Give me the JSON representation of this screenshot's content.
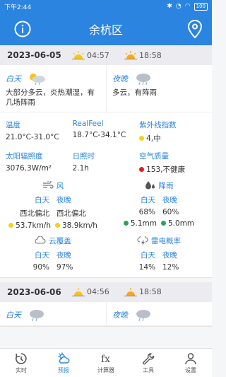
{
  "status": {
    "time": "下午2:44",
    "battery": "100"
  },
  "header": {
    "title": "余杭区"
  },
  "days": [
    {
      "date": "2023-06-05",
      "sunrise": "04:57",
      "sunset": "18:58",
      "day_label": "白天",
      "night_label": "夜晚",
      "day_desc": "大部分多云，炎热潮湿，有几场阵雨",
      "night_desc": "多云，有阵雨",
      "stats": {
        "temp_label": "温度",
        "temp_value": "21.0°C-31.0°C",
        "realfeel_label": "RealFeel",
        "realfeel_value": "18.7°C-34.1°C",
        "uv_label": "紫外线指数",
        "uv_value": "4,中",
        "solar_label": "太阳辐照度",
        "solar_value": "3076.3W/m²",
        "sunshine_label": "日照时",
        "sunshine_value": "2.1h",
        "aqi_label": "空气质量",
        "aqi_value": "153,不健康"
      },
      "wind": {
        "label": "风",
        "day": "白天",
        "night": "夜晚",
        "dir_day": "西北偏北",
        "dir_night": "西北偏北",
        "speed_day": "53.7km/h",
        "speed_night": "38.9km/h"
      },
      "rain": {
        "label": "降雨",
        "day": "白天",
        "night": "夜晚",
        "prob_day": "68%",
        "prob_night": "60%",
        "amt_day": "5.1mm",
        "amt_night": "5.0mm"
      },
      "cloud": {
        "label": "云覆盖",
        "day": "白天",
        "night": "夜晚",
        "val_day": "90%",
        "val_night": "97%"
      },
      "thunder": {
        "label": "雷电概率",
        "day": "白天",
        "night": "夜晚",
        "val_day": "14%",
        "val_night": "12%"
      }
    },
    {
      "date": "2023-06-06",
      "sunrise": "04:56",
      "sunset": "18:58",
      "day_label": "白天",
      "night_label": "夜晚"
    }
  ],
  "tabs": [
    {
      "label": "实时",
      "icon": "realtime-icon"
    },
    {
      "label": "预报",
      "icon": "forecast-icon"
    },
    {
      "label": "计算器",
      "icon": "calculator-icon"
    },
    {
      "label": "工具",
      "icon": "tools-icon"
    },
    {
      "label": "设置",
      "icon": "settings-icon"
    }
  ],
  "colors": {
    "accent": "#2a84e0",
    "yellow": "#f5d21a",
    "red": "#e02020",
    "green": "#2ea44f"
  }
}
